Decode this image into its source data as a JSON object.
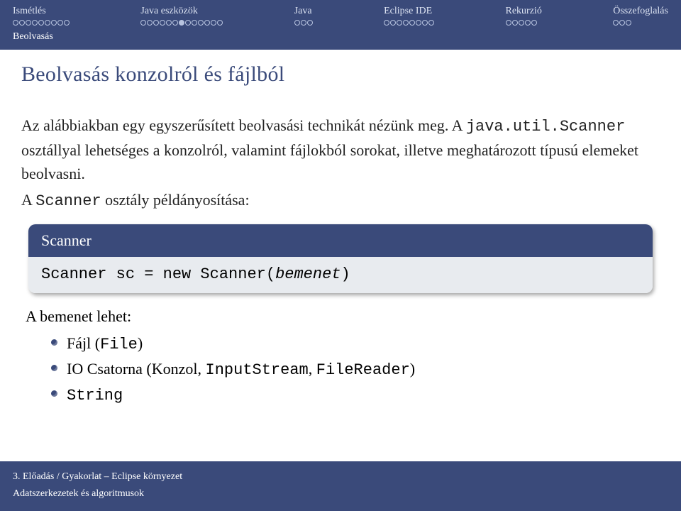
{
  "nav": {
    "items": [
      {
        "label": "Ismétlés",
        "total": 9,
        "filled": -1
      },
      {
        "label": "Java eszközök",
        "total": 13,
        "filled": 6
      },
      {
        "label": "Java",
        "total": 3,
        "filled": -1
      },
      {
        "label": "Eclipse IDE",
        "total": 8,
        "filled": -1
      },
      {
        "label": "Rekurzió",
        "total": 5,
        "filled": -1
      },
      {
        "label": "Összefoglalás",
        "total": 3,
        "filled": -1
      }
    ],
    "sub": "Beolvasás"
  },
  "title": "Beolvasás konzolról és fájlból",
  "para1_a": "Az alábbiakban egy egyszerűsített beolvasási technikát nézünk meg.",
  "para1_b_pre": "A ",
  "para1_b_tt": "java.util.Scanner",
  "para1_b_post": " osztállyal lehetséges a konzolról, valamint fájlokból sorokat, illetve meghatározott típusú elemeket beolvasni.",
  "para2_pre": "A ",
  "para2_tt": "Scanner",
  "para2_post": " osztály példányosítása:",
  "box": {
    "head": "Scanner",
    "code_a": "Scanner sc = new Scanner(",
    "code_i": "bemenet",
    "code_b": ")"
  },
  "list_intro": "A bemenet lehet:",
  "items": {
    "i0_a": "Fájl (",
    "i0_tt": "File",
    "i0_b": ")",
    "i1_a": "IO Csatorna (Konzol, ",
    "i1_tt1": "InputStream",
    "i1_mid": ", ",
    "i1_tt2": "FileReader",
    "i1_b": ")",
    "i2_tt": "String"
  },
  "footer": {
    "line1": "3. Előadás / Gyakorlat – Eclipse környezet",
    "line2": "Adatszerkezetek és algoritmusok"
  }
}
